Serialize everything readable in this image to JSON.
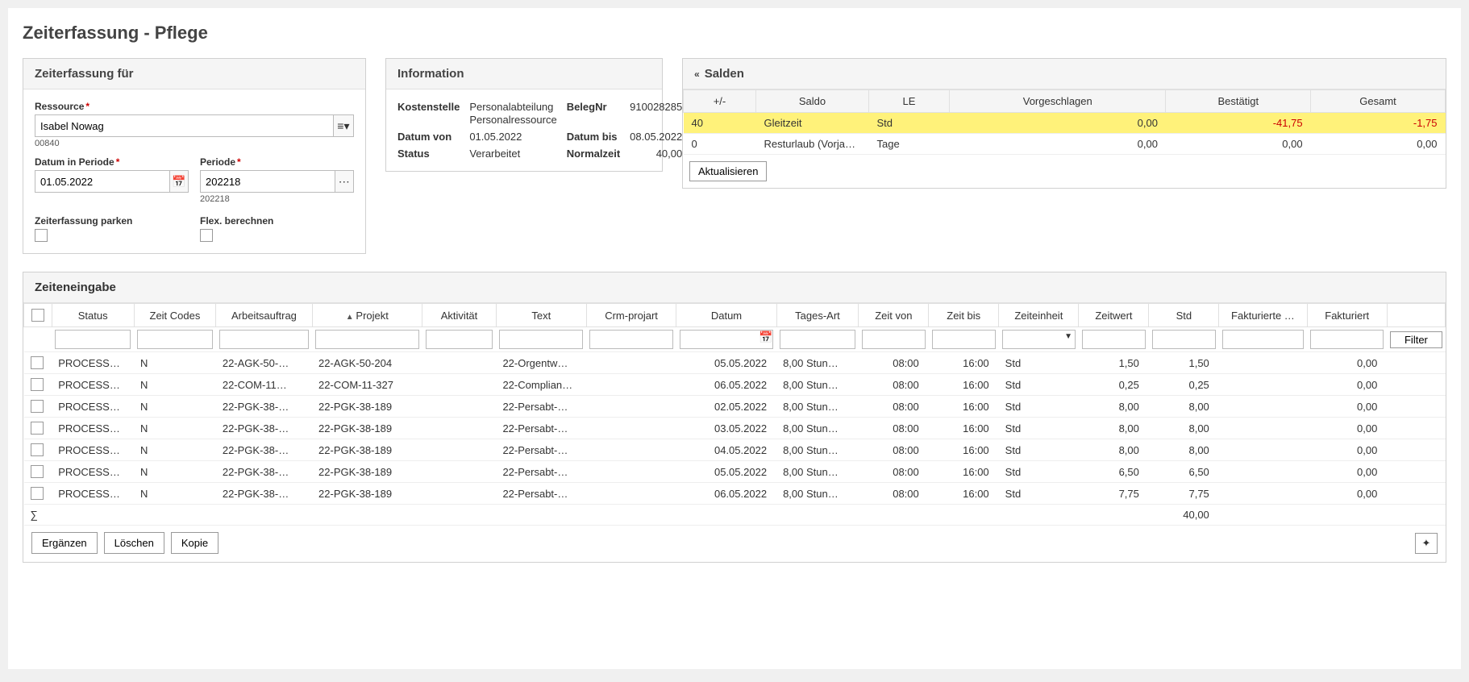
{
  "pageTitle": "Zeiterfassung - Pflege",
  "erfassung": {
    "title": "Zeiterfassung für",
    "labelRessource": "Ressource",
    "ressource": "Isabel Nowag",
    "ressourceCode": "00840",
    "labelDatum": "Datum in Periode",
    "datum": "01.05.2022",
    "labelPeriode": "Periode",
    "periode": "202218",
    "periodeCode": "202218",
    "labelParken": "Zeiterfassung parken",
    "labelFlex": "Flex. berechnen"
  },
  "info": {
    "title": "Information",
    "labelKostenstelle": "Kostenstelle",
    "kostenstelle": "Personalabteilung Personalressource",
    "labelBeleg": "BelegNr",
    "beleg": "910028285",
    "labelDatumVon": "Datum von",
    "datumVon": "01.05.2022",
    "labelDatumBis": "Datum bis",
    "datumBis": "08.05.2022",
    "labelStatus": "Status",
    "status": "Verarbeitet",
    "labelNormalzeit": "Normalzeit",
    "normalzeit": "40,00"
  },
  "saldo": {
    "title": "Salden",
    "headers": {
      "pm": "+/-",
      "saldo": "Saldo",
      "le": "LE",
      "vorg": "Vorgeschlagen",
      "best": "Bestätigt",
      "ges": "Gesamt"
    },
    "rows": [
      {
        "hl": true,
        "pm": "40",
        "saldo": "Gleitzeit",
        "le": "Std",
        "vorg": "0,00",
        "best": "-41,75",
        "ges": "-1,75",
        "bestNeg": true,
        "gesNeg": true
      },
      {
        "hl": false,
        "pm": "0",
        "saldo": "Resturlaub (Vorja…",
        "le": "Tage",
        "vorg": "0,00",
        "best": "0,00",
        "ges": "0,00",
        "bestNeg": false,
        "gesNeg": false
      }
    ],
    "btnRefresh": "Aktualisieren"
  },
  "timeEntry": {
    "title": "Zeiteneingabe",
    "headers": {
      "status": "Status",
      "zeitCodes": "Zeit Codes",
      "arbeit": "Arbeitsauftrag",
      "projekt": "Projekt",
      "aktivitaet": "Aktivität",
      "text": "Text",
      "crm": "Crm-projart",
      "datum": "Datum",
      "tagesart": "Tages-Art",
      "zeitvon": "Zeit von",
      "zeitbis": "Zeit bis",
      "zeiteinheit": "Zeiteinheit",
      "zeitwert": "Zeitwert",
      "std": "Std",
      "fakt": "Fakturierte …",
      "fakturiert": "Fakturiert"
    },
    "filterBtn": "Filter",
    "rows": [
      {
        "status": "PROCESS…",
        "zc": "N",
        "arb": "22-AGK-50-…",
        "prj": "22-AGK-50-204",
        "akt": "",
        "txt": "22-Orgentw…",
        "crm": "",
        "datum": "05.05.2022",
        "tag": "8,00 Stun…",
        "von": "08:00",
        "bis": "16:00",
        "ze": "Std",
        "zw": "1,50",
        "std": "1,50",
        "fk": "",
        "fakt": "0,00"
      },
      {
        "status": "PROCESS…",
        "zc": "N",
        "arb": "22-COM-11…",
        "prj": "22-COM-11-327",
        "akt": "",
        "txt": "22-Complian…",
        "crm": "",
        "datum": "06.05.2022",
        "tag": "8,00 Stun…",
        "von": "08:00",
        "bis": "16:00",
        "ze": "Std",
        "zw": "0,25",
        "std": "0,25",
        "fk": "",
        "fakt": "0,00"
      },
      {
        "status": "PROCESS…",
        "zc": "N",
        "arb": "22-PGK-38-…",
        "prj": "22-PGK-38-189",
        "akt": "",
        "txt": "22-Persabt-…",
        "crm": "",
        "datum": "02.05.2022",
        "tag": "8,00 Stun…",
        "von": "08:00",
        "bis": "16:00",
        "ze": "Std",
        "zw": "8,00",
        "std": "8,00",
        "fk": "",
        "fakt": "0,00"
      },
      {
        "status": "PROCESS…",
        "zc": "N",
        "arb": "22-PGK-38-…",
        "prj": "22-PGK-38-189",
        "akt": "",
        "txt": "22-Persabt-…",
        "crm": "",
        "datum": "03.05.2022",
        "tag": "8,00 Stun…",
        "von": "08:00",
        "bis": "16:00",
        "ze": "Std",
        "zw": "8,00",
        "std": "8,00",
        "fk": "",
        "fakt": "0,00"
      },
      {
        "status": "PROCESS…",
        "zc": "N",
        "arb": "22-PGK-38-…",
        "prj": "22-PGK-38-189",
        "akt": "",
        "txt": "22-Persabt-…",
        "crm": "",
        "datum": "04.05.2022",
        "tag": "8,00 Stun…",
        "von": "08:00",
        "bis": "16:00",
        "ze": "Std",
        "zw": "8,00",
        "std": "8,00",
        "fk": "",
        "fakt": "0,00"
      },
      {
        "status": "PROCESS…",
        "zc": "N",
        "arb": "22-PGK-38-…",
        "prj": "22-PGK-38-189",
        "akt": "",
        "txt": "22-Persabt-…",
        "crm": "",
        "datum": "05.05.2022",
        "tag": "8,00 Stun…",
        "von": "08:00",
        "bis": "16:00",
        "ze": "Std",
        "zw": "6,50",
        "std": "6,50",
        "fk": "",
        "fakt": "0,00"
      },
      {
        "status": "PROCESS…",
        "zc": "N",
        "arb": "22-PGK-38-…",
        "prj": "22-PGK-38-189",
        "akt": "",
        "txt": "22-Persabt-…",
        "crm": "",
        "datum": "06.05.2022",
        "tag": "8,00 Stun…",
        "von": "08:00",
        "bis": "16:00",
        "ze": "Std",
        "zw": "7,75",
        "std": "7,75",
        "fk": "",
        "fakt": "0,00"
      }
    ],
    "sumSymbol": "∑",
    "sumStd": "40,00",
    "btnErg": "Ergänzen",
    "btnLoeschen": "Löschen",
    "btnKopie": "Kopie"
  }
}
